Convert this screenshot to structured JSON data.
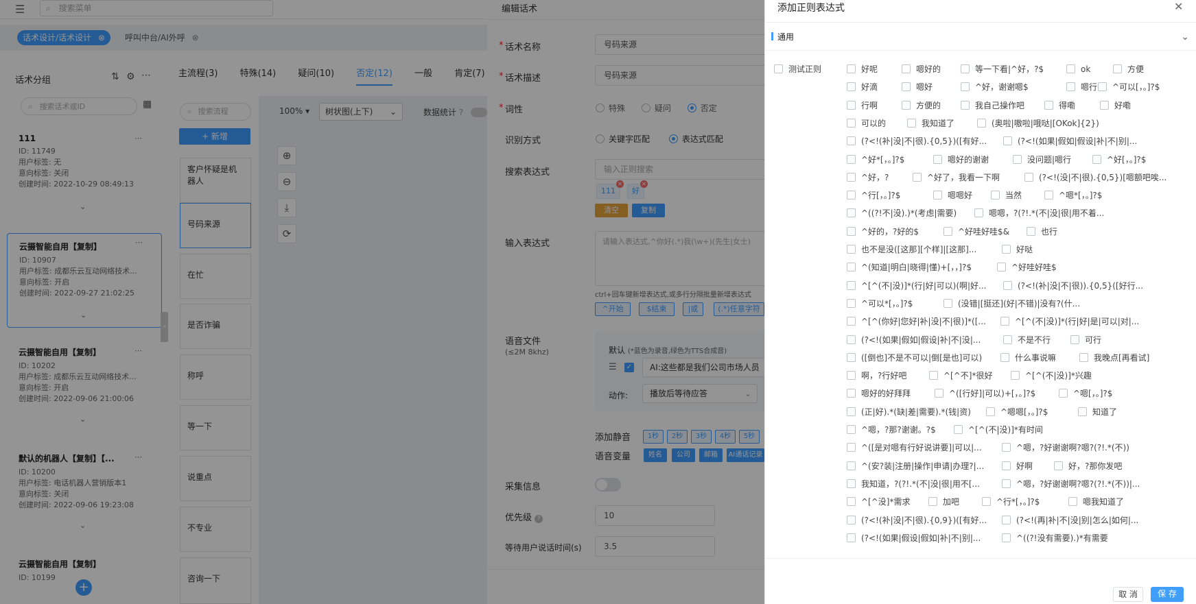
{
  "app": {
    "search_placeholder": "搜索菜单",
    "tabs": [
      {
        "label": "话术设计/话术设计",
        "active": true
      },
      {
        "label": "呼叫中台/AI外呼",
        "active": false
      }
    ]
  },
  "left_panel": {
    "title": "话术分组",
    "search_placeholder": "搜索话术或ID",
    "field_labels": {
      "user_tag": "用户标签:",
      "intent_tag": "意向标签:",
      "created": "创建时间:"
    },
    "cards": [
      {
        "name": "111",
        "id": "ID: 11749",
        "user_tag": "无",
        "intent_tag": "关闭",
        "created": "2022-10-29 08:49:13"
      },
      {
        "name": "云摄智能自用【复制】",
        "id": "ID: 10907",
        "user_tag": "成都乐云互动网络技术...",
        "intent_tag": "开启",
        "created": "2022-09-27 21:02:25"
      },
      {
        "name": "云摄智能自用【复制】",
        "id": "ID: 10202",
        "user_tag": "成都乐云互动网络技术...",
        "intent_tag": "开启",
        "created": "2022-09-06 21:00:06"
      },
      {
        "name": "默认的机器人【复制】【...",
        "id": "ID: 10200",
        "user_tag": "电话机器人营销版本1",
        "intent_tag": "关闭",
        "created": "2022-09-06 19:23:08"
      },
      {
        "name": "云摄智能自用【复制】",
        "id": "ID: 10199"
      }
    ]
  },
  "flow_panel": {
    "tabs": [
      "主流程(3)",
      "特殊(14)",
      "疑问(10)",
      "否定(12)",
      "一般",
      "肯定(7)"
    ],
    "search_placeholder": "搜索流程",
    "new_button": "+ 新增",
    "items": [
      "客户怀疑是机器人",
      "号码来源",
      "在忙",
      "是否诈骗",
      "称呼",
      "等一下",
      "说重点",
      "不专业",
      "咨询一下"
    ],
    "zoom": "100%",
    "layout_select": "树状图(上下)",
    "stats_label": "数据统计"
  },
  "edit_form": {
    "header": "编辑话术",
    "name_label": "话术名称",
    "name_value": "号码来源",
    "desc_label": "话术描述",
    "desc_value": "号码来源",
    "tone_label": "词性",
    "tone_options": [
      "特殊",
      "疑问",
      "否定"
    ],
    "match_label": "识别方式",
    "match_options": [
      "关键字匹配",
      "表达式匹配"
    ],
    "search_expr_label": "搜索表达式",
    "search_expr_placeholder": "输入正则搜索",
    "expr_tags": [
      "111",
      "好"
    ],
    "clear_btn": "清空",
    "copy_btn": "复制",
    "input_expr_label": "输入表达式",
    "input_expr_placeholder": "请输入表达式,^你好(.*)我(\\w+)(先生|女士)",
    "input_hint": "ctrl+回车键新增表达式,或多行分隔批量新增表达式",
    "quick_btns": [
      "^开始",
      "$结束",
      "|或",
      "(.*)任意字符"
    ],
    "voice_label": "语音文件",
    "voice_sub": "(≤2M 8khz)",
    "voice_default": "默认",
    "voice_note": "(*蓝色为录音,绿色为TTS合成音)",
    "voice_text": "AI:这些都是我们公司市场人员",
    "action_label": "动作:",
    "action_value": "播放后等待应答",
    "silence_label": "添加静音",
    "silence_btns": [
      "1秒",
      "2秒",
      "3秒",
      "4秒",
      "5秒"
    ],
    "var_label": "语音变量",
    "var_btns": [
      "姓名",
      "公司",
      "邮箱",
      "AI通话记录"
    ],
    "collect_label": "采集信息",
    "priority_label": "优先级",
    "priority_value": "10",
    "wait_label": "等待用户说话时间(s)",
    "wait_value": "3.5"
  },
  "drawer": {
    "title": "添加正则表达式",
    "section": "通用",
    "test_label": "测试正则",
    "options": [
      [
        "好呢",
        "嗯好的",
        "等一下看|^好，?$",
        "ok",
        "方便"
      ],
      [
        "好滴",
        "嗯好",
        "^好，谢谢嗯$",
        "嗯行",
        "^可以[，。]?$"
      ],
      [
        "行啊",
        "方便的",
        "我自己操作吧",
        "得嘞",
        "好嘞"
      ],
      [
        "可以的",
        "我知道了",
        "(奥啦|嗷啦|哦哒|[OKok]{2})"
      ],
      [
        "(?<!(补|没|不|很).{0,5})([有好...",
        "(?<!(如果|假如|假设|补|不|别|..."
      ],
      [
        "^好*[，。]?$",
        "嗯好的谢谢",
        "没问题|嗯行",
        "^好[，。]?$"
      ],
      [
        "^好，?",
        "^好了，我看一下啊",
        "(?<!(没|不|很).{0,5})[嗯额吧唉..."
      ],
      [
        "^行[，。]?$",
        "嗯嗯好",
        "当然",
        "^嗯*[，。]?$"
      ],
      [
        "^((?!不|没).)*(考虑|需要)",
        "嗯嗯，?(?!.*(不|没|很|用不着..."
      ],
      [
        "^好的，?好的$",
        "^好哇好哇$&",
        "也行"
      ],
      [
        "也不是没([这那][个样]|[这那]...",
        "好哒"
      ],
      [
        "^(知道|明白|晓得|懂)+[，，]?$",
        "^好哇好哇$"
      ],
      [
        "^[^(不|没)]*(行|好|可以)(啊|好...",
        "(?<!(补|没|不|很)).{0,5}([好行..."
      ],
      [
        "^可以*[，。]?$",
        "(没错|[挺还](好|不错)|没有?(什..."
      ],
      [
        "^[^(你好|您好|补|没|不|很)]*([...",
        "^[^(不|没)]*(行|好|是|可以|对|..."
      ],
      [
        "(?<!(如果|假如|假设|补|不|没|...",
        "不是不行",
        "可行"
      ],
      [
        "([倒也]不是不可以|倒[是也]可以)",
        "什么事说嘛",
        "我晚点[再看试]"
      ],
      [
        "啊，?行好吧",
        "^[^不]*很好",
        "^[^(不|没)]*兴趣"
      ],
      [
        "嗯好的好拜拜",
        "^([行好]|可以)+[，。]?$",
        "^嗯[，。]?$"
      ],
      [
        "(正|好).*(缺|差|需要).*(钱|资)",
        "^嗯嗯[，。]?$",
        "知道了"
      ],
      [
        "^嗯，?那?谢谢。?$",
        "^[^(不|没)]*有时间"
      ],
      [
        "^([是对嗯有行好说讲要]|可以|...",
        "^嗯，?好谢谢啊?嗯?(?!.*(不))"
      ],
      [
        "^(安?装|注册|操作|申请|办理?|...",
        "好啊",
        "好，?那你发吧"
      ],
      [
        "我知道，?(?!.*(不|没|很|用不[...",
        "^嗯，?好谢谢啊?嗯?(?!.*(不))|..."
      ],
      [
        "^[^没]*需求",
        "加吧",
        "^行*[，。]?$",
        "嗯我知道了"
      ],
      [
        "(?<!(补|没|不|很).{0,9})([有好...",
        "(?<!(再|补|不|没|别|怎么|如何|..."
      ],
      [
        "(?<!(如果|假设|假如|补|不|别|...",
        "^((?!没有需要).)*有需要"
      ]
    ],
    "cancel": "取 消",
    "save": "保 存"
  }
}
